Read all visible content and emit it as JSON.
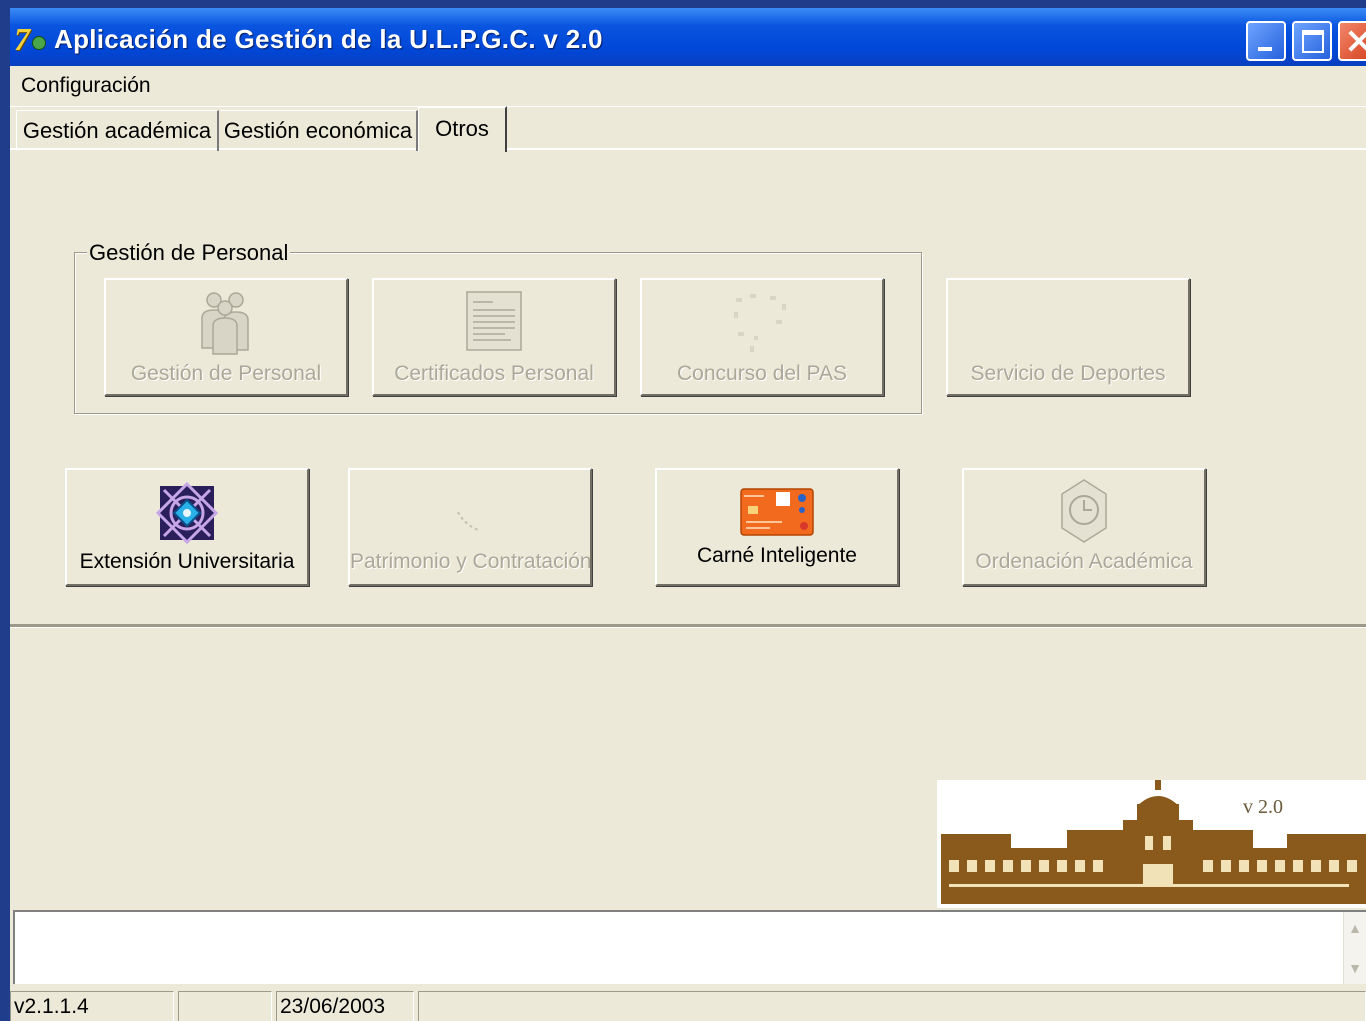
{
  "window": {
    "title": "Aplicación de Gestión de la U.L.P.G.C.  v 2.0"
  },
  "menu": {
    "items": [
      "Configuración"
    ]
  },
  "tabs": [
    {
      "label": "Gestión académica",
      "selected": false
    },
    {
      "label": "Gestión económica",
      "selected": false
    },
    {
      "label": "Otros",
      "selected": true
    }
  ],
  "group": {
    "label": "Gestión de Personal"
  },
  "buttons": [
    {
      "label": "Gestión de Personal",
      "enabled": false,
      "icon": "people-icon"
    },
    {
      "label": "Certificados Personal",
      "enabled": false,
      "icon": "document-icon"
    },
    {
      "label": "Concurso del PAS",
      "enabled": false,
      "icon": "contest-icon"
    },
    {
      "label": "Servicio de Deportes",
      "enabled": false,
      "icon": ""
    },
    {
      "label": "Extensión Universitaria",
      "enabled": true,
      "icon": "university-emblem-icon"
    },
    {
      "label": "Patrimonio y Contratación",
      "enabled": false,
      "icon": "patrimony-icon"
    },
    {
      "label": "Carné Inteligente",
      "enabled": true,
      "icon": "smart-card-icon"
    },
    {
      "label": "Ordenación Académica",
      "enabled": false,
      "icon": "clock-icon"
    }
  ],
  "logo": {
    "version": "v 2.0"
  },
  "statusbar": {
    "version": "v2.1.1.4",
    "panel2": "",
    "date": "23/06/2003",
    "panel4": ""
  },
  "colors": {
    "titlebar": "#0047d8",
    "window_bg": "#ece9d8",
    "disabled_text": "#aca899",
    "close_button": "#d4401c"
  }
}
